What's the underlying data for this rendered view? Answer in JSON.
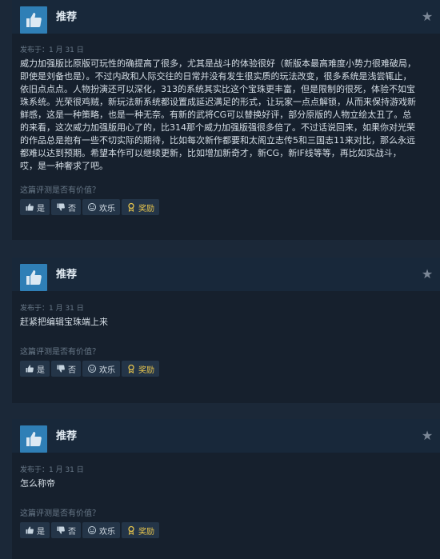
{
  "reviews": [
    {
      "title": "推荐",
      "posted": "发布于：1 月 31 日",
      "text": "威力加强版比原版可玩性的确提高了很多，尤其是战斗的体验很好（新版本最高难度小势力很难破局，\n即使是刘备也是）。不过内政和人际交往的日常并没有发生很实质的玩法改变，很多系统是浅尝辄止，\n依旧点点点。人物扮演还可以深化，313的系统其实比这个宝珠更丰富，但是限制的很死，体验不如宝\n珠系统。光荣很鸡贼，新玩法新系统都设置成延迟满足的形式，让玩家一点点解锁，从而来保持游戏新\n鲜感，这是一种策略，也是一种无奈。有新的武将CG可以替换好评，部分原版的人物立绘太丑了。总\n的来看，这次威力加强版用心了的，比314那个威力加强版强很多倍了。不过话说回来，如果你对光荣\n的作品总是抱有一些不切实际的期待，比如每次新作都要和太阁立志传5和三国志11来对比，那么永远\n都难以达到预期。希望本作可以继续更新，比如增加新奇才，新CG，新IF线等等，再比如实战斗，\n哎，是一种奢求了吧。",
      "helpful_question": "这篇评测是否有价值？",
      "buttons": {
        "yes": "是",
        "no": "否",
        "funny": "欢乐",
        "award": "奖励"
      }
    },
    {
      "title": "推荐",
      "posted": "发布于：1 月 31 日",
      "text": "赶紧把编辑宝珠端上来",
      "helpful_question": "这篇评测是否有价值？",
      "buttons": {
        "yes": "是",
        "no": "否",
        "funny": "欢乐",
        "award": "奖励"
      }
    },
    {
      "title": "推荐",
      "posted": "发布于：1 月 31 日",
      "text": "怎么称帝",
      "helpful_question": "这篇评测是否有价值？",
      "buttons": {
        "yes": "是",
        "no": "否",
        "funny": "欢乐",
        "award": "奖励"
      }
    }
  ]
}
